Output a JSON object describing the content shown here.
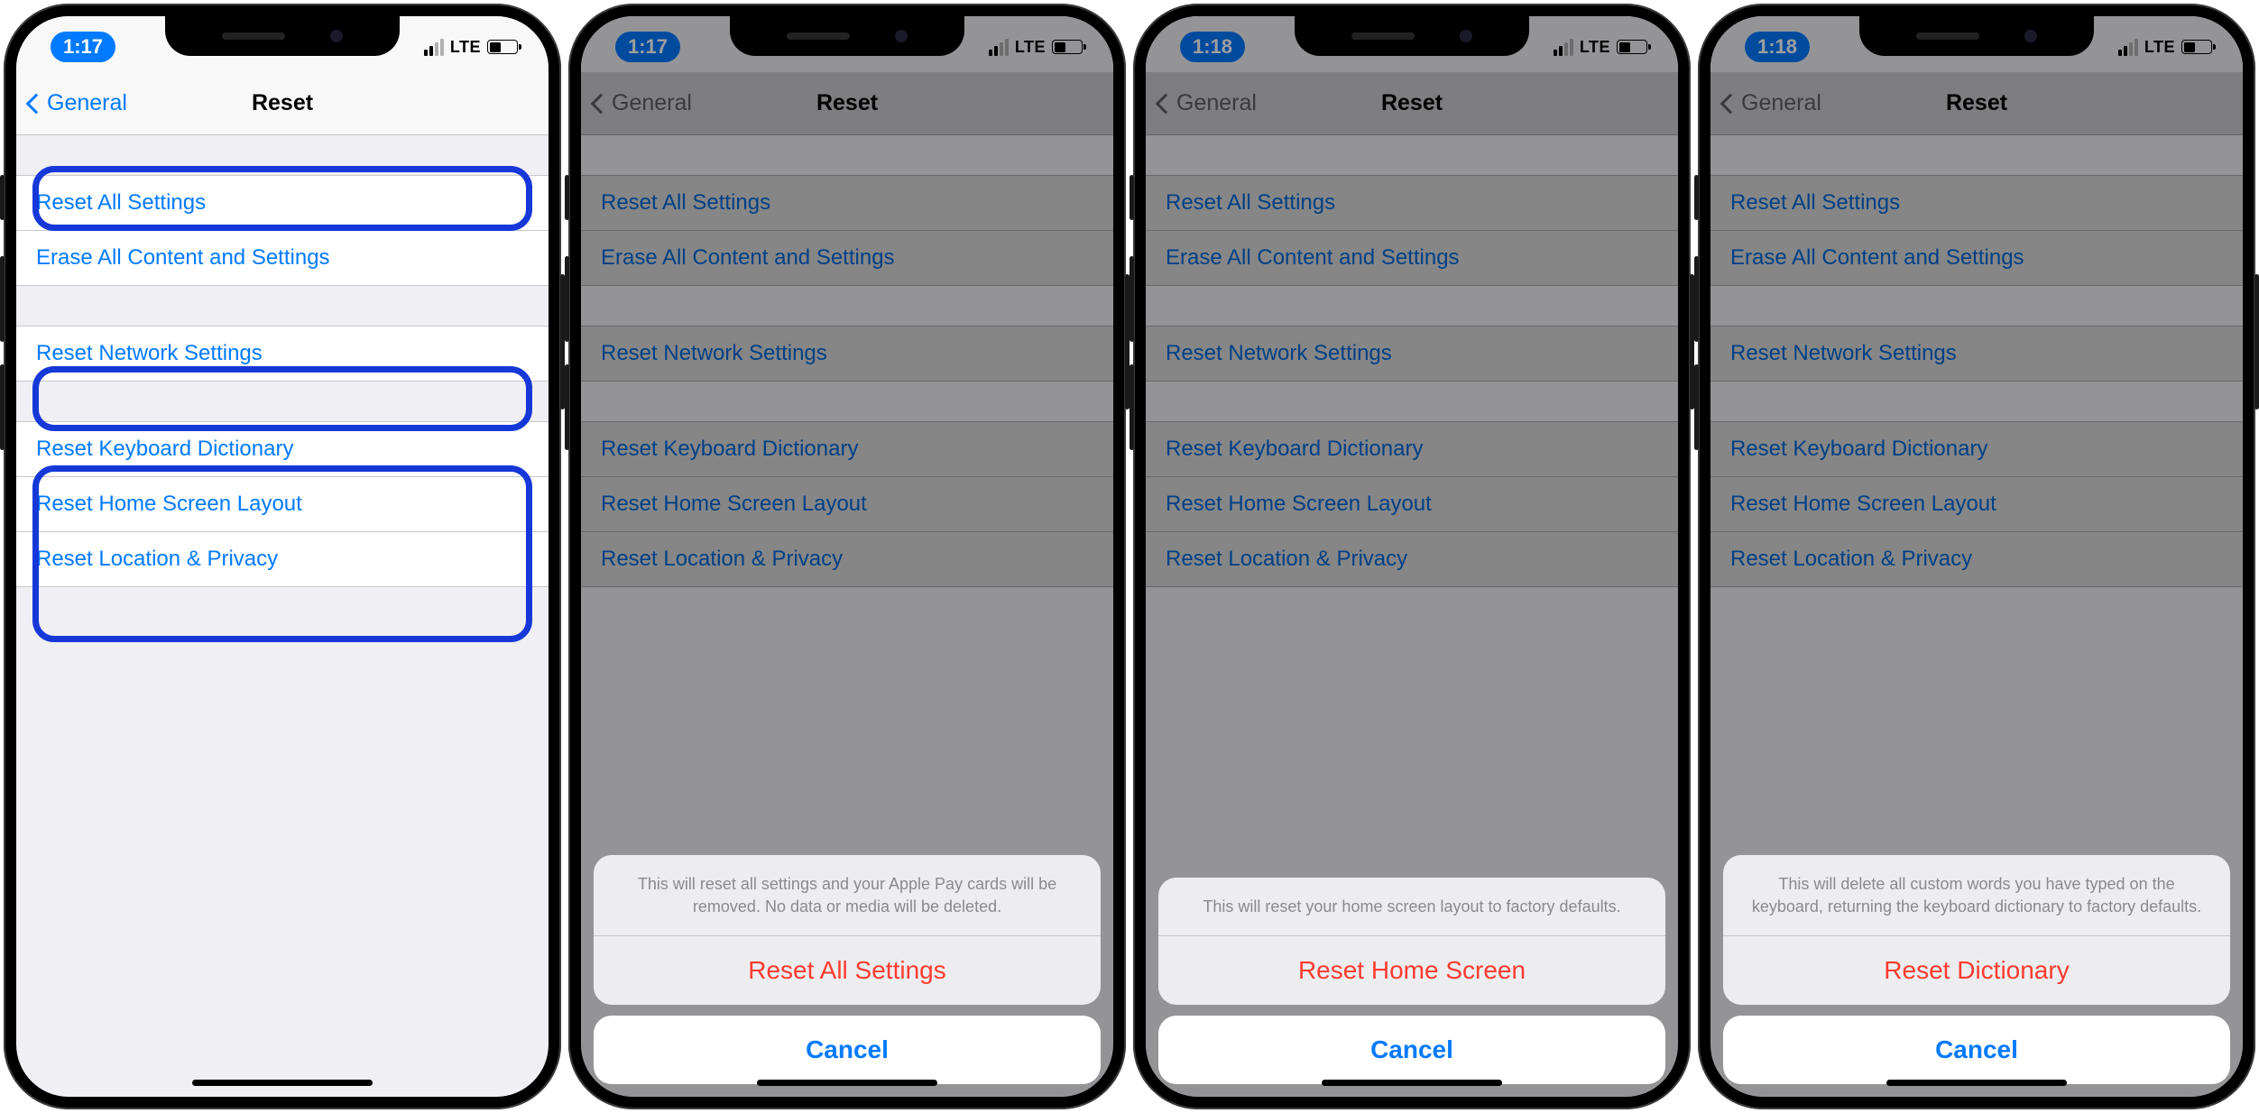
{
  "phones": [
    {
      "time": "1:17",
      "carrier": "LTE",
      "back_label": "General",
      "title": "Reset",
      "groups": [
        [
          "Reset All Settings",
          "Erase All Content and Settings"
        ],
        [
          "Reset Network Settings"
        ],
        [
          "Reset Keyboard Dictionary",
          "Reset Home Screen Layout",
          "Reset Location & Privacy"
        ]
      ],
      "highlights": true,
      "sheet": null
    },
    {
      "time": "1:17",
      "carrier": "LTE",
      "back_label": "General",
      "title": "Reset",
      "groups": [
        [
          "Reset All Settings",
          "Erase All Content and Settings"
        ],
        [
          "Reset Network Settings"
        ],
        [
          "Reset Keyboard Dictionary",
          "Reset Home Screen Layout",
          "Reset Location & Privacy"
        ]
      ],
      "highlights": false,
      "sheet": {
        "message": "This will reset all settings and your Apple Pay cards will be removed. No data or media will be deleted.",
        "action": "Reset All Settings",
        "cancel": "Cancel"
      }
    },
    {
      "time": "1:18",
      "carrier": "LTE",
      "back_label": "General",
      "title": "Reset",
      "groups": [
        [
          "Reset All Settings",
          "Erase All Content and Settings"
        ],
        [
          "Reset Network Settings"
        ],
        [
          "Reset Keyboard Dictionary",
          "Reset Home Screen Layout",
          "Reset Location & Privacy"
        ]
      ],
      "highlights": false,
      "sheet": {
        "message": "This will reset your home screen layout to factory defaults.",
        "action": "Reset Home Screen",
        "cancel": "Cancel"
      }
    },
    {
      "time": "1:18",
      "carrier": "LTE",
      "back_label": "General",
      "title": "Reset",
      "groups": [
        [
          "Reset All Settings",
          "Erase All Content and Settings"
        ],
        [
          "Reset Network Settings"
        ],
        [
          "Reset Keyboard Dictionary",
          "Reset Home Screen Layout",
          "Reset Location & Privacy"
        ]
      ],
      "highlights": false,
      "sheet": {
        "message": "This will delete all custom words you have typed on the keyboard, returning the keyboard dictionary to factory defaults.",
        "action": "Reset Dictionary",
        "cancel": "Cancel"
      }
    }
  ]
}
